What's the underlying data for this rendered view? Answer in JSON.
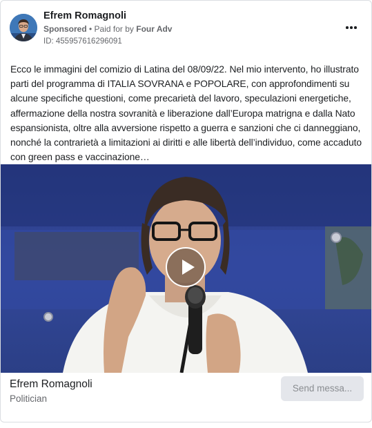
{
  "header": {
    "name": "Efrem Romagnoli",
    "sponsored": "Sponsored",
    "paid_for_prefix": "• Paid for by",
    "payer": "Four Adv",
    "ad_id": "ID: 455957616296091",
    "more_icon": "more-horizontal-icon"
  },
  "post": {
    "text": "Ecco le immagini del comizio di Latina del 08/09/22. Nel mio intervento, ho illustrato parti del programma di ITALIA SOVRANA e POPOLARE, con approfondimenti su alcune specifiche questioni, come precarietà del lavoro, speculazioni energetiche, affermazione della nostra sovranità e liberazione dall’Europa matrigna e dalla Nato espansionista, oltre alla avversione rispetto a guerra e sanzioni che ci danneggiano, nonché la contrarietà a limitazioni ai diritti e alle libertà dell’individuo, come accaduto con green pass e vaccinazione…"
  },
  "video": {
    "play_icon": "play-icon"
  },
  "footer": {
    "page_name": "Efrem Romagnoli",
    "category": "Politician",
    "send_label": "Send messa..."
  }
}
